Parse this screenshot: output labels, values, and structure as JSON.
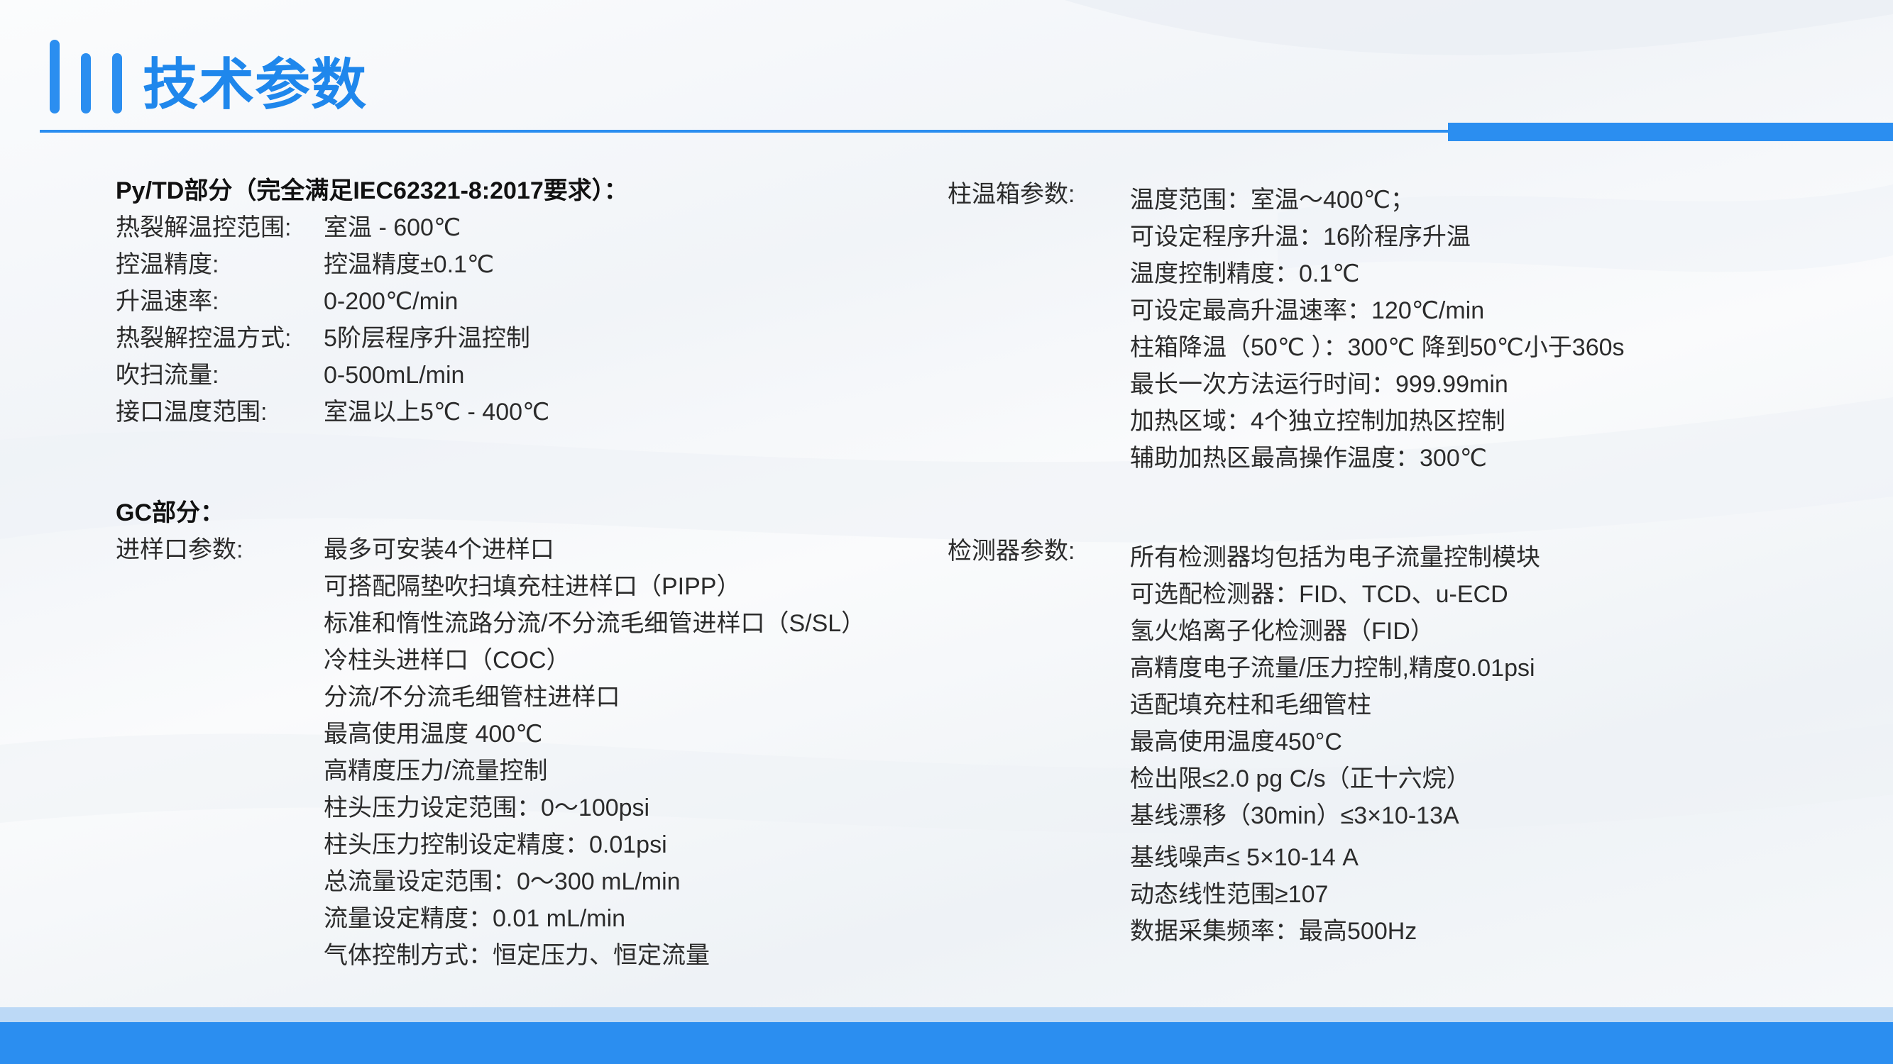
{
  "slide": {
    "title": "技术参数",
    "colors": {
      "accent": "#2b8ef0",
      "title": "#1f87ec",
      "text": "#2b2b2b",
      "footer_light": "#bcd9f6"
    },
    "icons": {
      "title_icon": "three-vertical-bars-icon"
    }
  },
  "pytd": {
    "heading": "Py/TD部分（完全满足IEC62321-8:2017要求）：",
    "rows": [
      {
        "label": "热裂解温控范围:",
        "value": "室温 - 600℃"
      },
      {
        "label": "控温精度:",
        "value": "控温精度±0.1℃"
      },
      {
        "label": "升温速率:",
        "value": "0-200℃/min"
      },
      {
        "label": "热裂解控温方式:",
        "value": "5阶层程序升温控制"
      },
      {
        "label": "吹扫流量:",
        "value": "0-500mL/min"
      },
      {
        "label": "接口温度范围:",
        "value": "室温以上5℃ - 400℃"
      }
    ]
  },
  "gc": {
    "heading": "GC部分：",
    "inlet": {
      "label": "进样口参数:",
      "values": [
        "最多可安装4个进样口",
        "可搭配隔垫吹扫填充柱进样口（PIPP）",
        "标准和惰性流路分流/不分流毛细管进样口（S/SL）",
        "冷柱头进样口（COC）",
        "分流/不分流毛细管柱进样口",
        "最高使用温度 400℃",
        "高精度压力/流量控制",
        "柱头压力设定范围：0～100psi",
        "柱头压力控制设定精度：0.01psi",
        "总流量设定范围：0～300 mL/min",
        "流量设定精度：0.01 mL/min",
        "气体控制方式：恒定压力、恒定流量"
      ]
    }
  },
  "oven": {
    "label": "柱温箱参数:",
    "values": [
      "温度范围：室温～400℃；",
      "可设定程序升温：16阶程序升温",
      "温度控制精度：0.1℃",
      "可设定最高升温速率：120℃/min",
      "柱箱降温（50℃ ）：300℃ 降到50℃小于360s",
      "最长一次方法运行时间：999.99min",
      "加热区域：4个独立控制加热区控制",
      "辅助加热区最高操作温度：300℃"
    ]
  },
  "detector": {
    "label": "检测器参数:",
    "values": [
      "所有检测器均包括为电子流量控制模块",
      "可选配检测器：FID、TCD、u-ECD",
      "氢火焰离子化检测器（FID）",
      "高精度电子流量/压力控制,精度0.01psi",
      "适配填充柱和毛细管柱",
      "最高使用温度450°C",
      "检出限≤2.0 pg C/s（正十六烷）",
      "基线漂移（30min）≤3×10-13A",
      "基线噪声≤ 5×10-14 A",
      "动态线性范围≥107",
      "数据采集频率：最高500Hz"
    ]
  }
}
